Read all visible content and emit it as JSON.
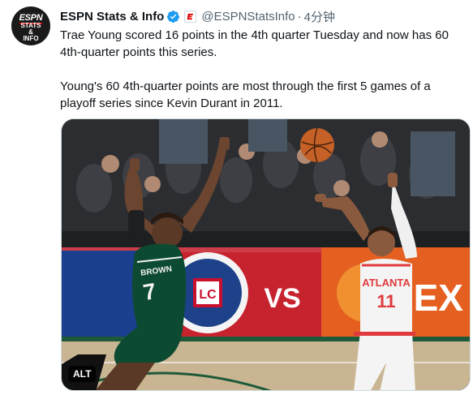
{
  "tweet": {
    "author_name": "ESPN Stats & Info",
    "handle": "@ESPNStatsInfo",
    "separator": "·",
    "time": "4分钟",
    "paragraphs": [
      "Trae Young scored 16 points in the 4th quarter Tuesday and now has 60 4th-quarter points this series.",
      "Young's 60 4th-quarter points are most through the first 5 games of a playoff series since Kevin Durant in 2011."
    ]
  },
  "avatar": {
    "logo_text": "ESPN",
    "line1": "STATS",
    "line2": "&",
    "line3": "INFO"
  },
  "media": {
    "alt_label": "ALT",
    "ad_vs": "VS",
    "ad_right": "NEX",
    "jersey_left_text": "BROWN",
    "jersey_left_number": "7",
    "jersey_right_text": "ATLANTA",
    "jersey_right_number": "11"
  },
  "colors": {
    "verified_blue": "#1d9bf0",
    "handle_gray": "#536471",
    "celtics_green": "#0d4a32",
    "hawks_red": "#e03a3e"
  }
}
